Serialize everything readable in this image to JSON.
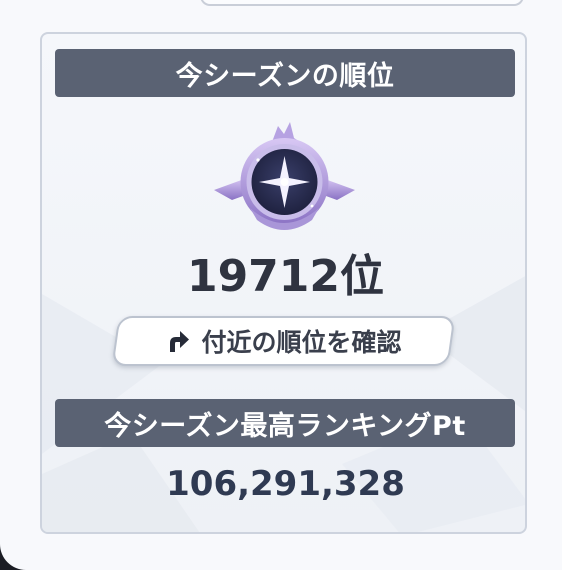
{
  "current_season": {
    "header": "今シーズンの順位",
    "rank_text": "19712位",
    "rank_emblem_icon": "rank-emblem-icon"
  },
  "nearby_button": {
    "label": "付近の順位を確認",
    "icon": "forward-arrow-icon"
  },
  "best_ranking": {
    "header": "今シーズン最高ランキングPt",
    "points": "106,291,328"
  },
  "colors": {
    "header_bg": "#5a6273",
    "panel_bg": "#eef1f6",
    "text_dark": "#2f3340",
    "emblem_purple": "#6a5aa8"
  }
}
